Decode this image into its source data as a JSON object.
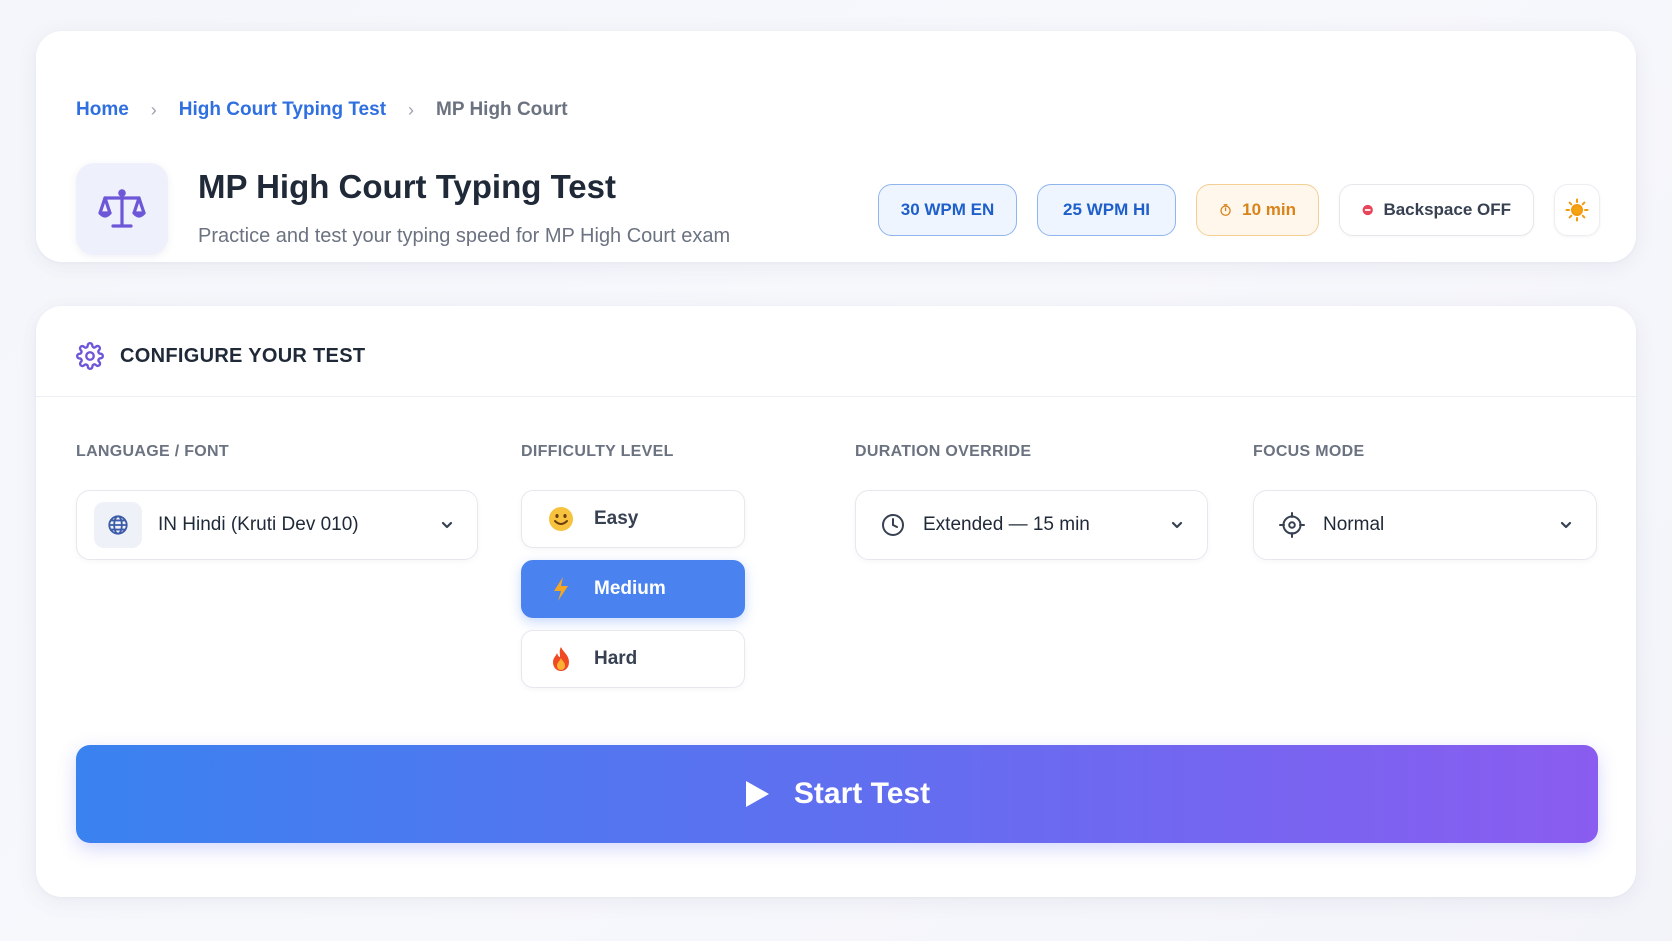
{
  "breadcrumb": {
    "home": "Home",
    "parent": "High Court Typing Test",
    "current": "MP High Court",
    "separator": "›"
  },
  "header": {
    "title": "MP High Court Typing Test",
    "subtitle": "Practice and test your typing speed for MP High Court exam",
    "logo_icon": "scales-of-justice-icon"
  },
  "badges": {
    "english_speed": "30 WPM EN",
    "hindi_speed": "25 WPM HI",
    "duration": "10 min",
    "backspace": "Backspace OFF"
  },
  "theme_toggle": {
    "icon": "sun-icon"
  },
  "config": {
    "title": "CONFIGURE YOUR TEST",
    "language": {
      "label": "LANGUAGE / FONT",
      "value": "IN Hindi (Kruti Dev 010)"
    },
    "difficulty": {
      "label": "DIFFICULTY LEVEL",
      "options": [
        {
          "label": "Easy",
          "icon": "smile-emoji"
        },
        {
          "label": "Medium",
          "icon": "lightning-emoji"
        },
        {
          "label": "Hard",
          "icon": "fire-emoji"
        }
      ],
      "selected": "Medium"
    },
    "duration": {
      "label": "DURATION OVERRIDE",
      "value": "Extended — 15 min"
    },
    "focus": {
      "label": "FOCUS MODE",
      "value": "Normal"
    },
    "start_label": "Start Test"
  },
  "colors": {
    "accent_blue": "#2f6fe0",
    "active_difficulty": "#4a82f0",
    "gradient_start": "#3a82f0",
    "gradient_end": "#8a5cf0",
    "duration_badge": "#d9831a",
    "backspace_dot": "#e8445a"
  }
}
